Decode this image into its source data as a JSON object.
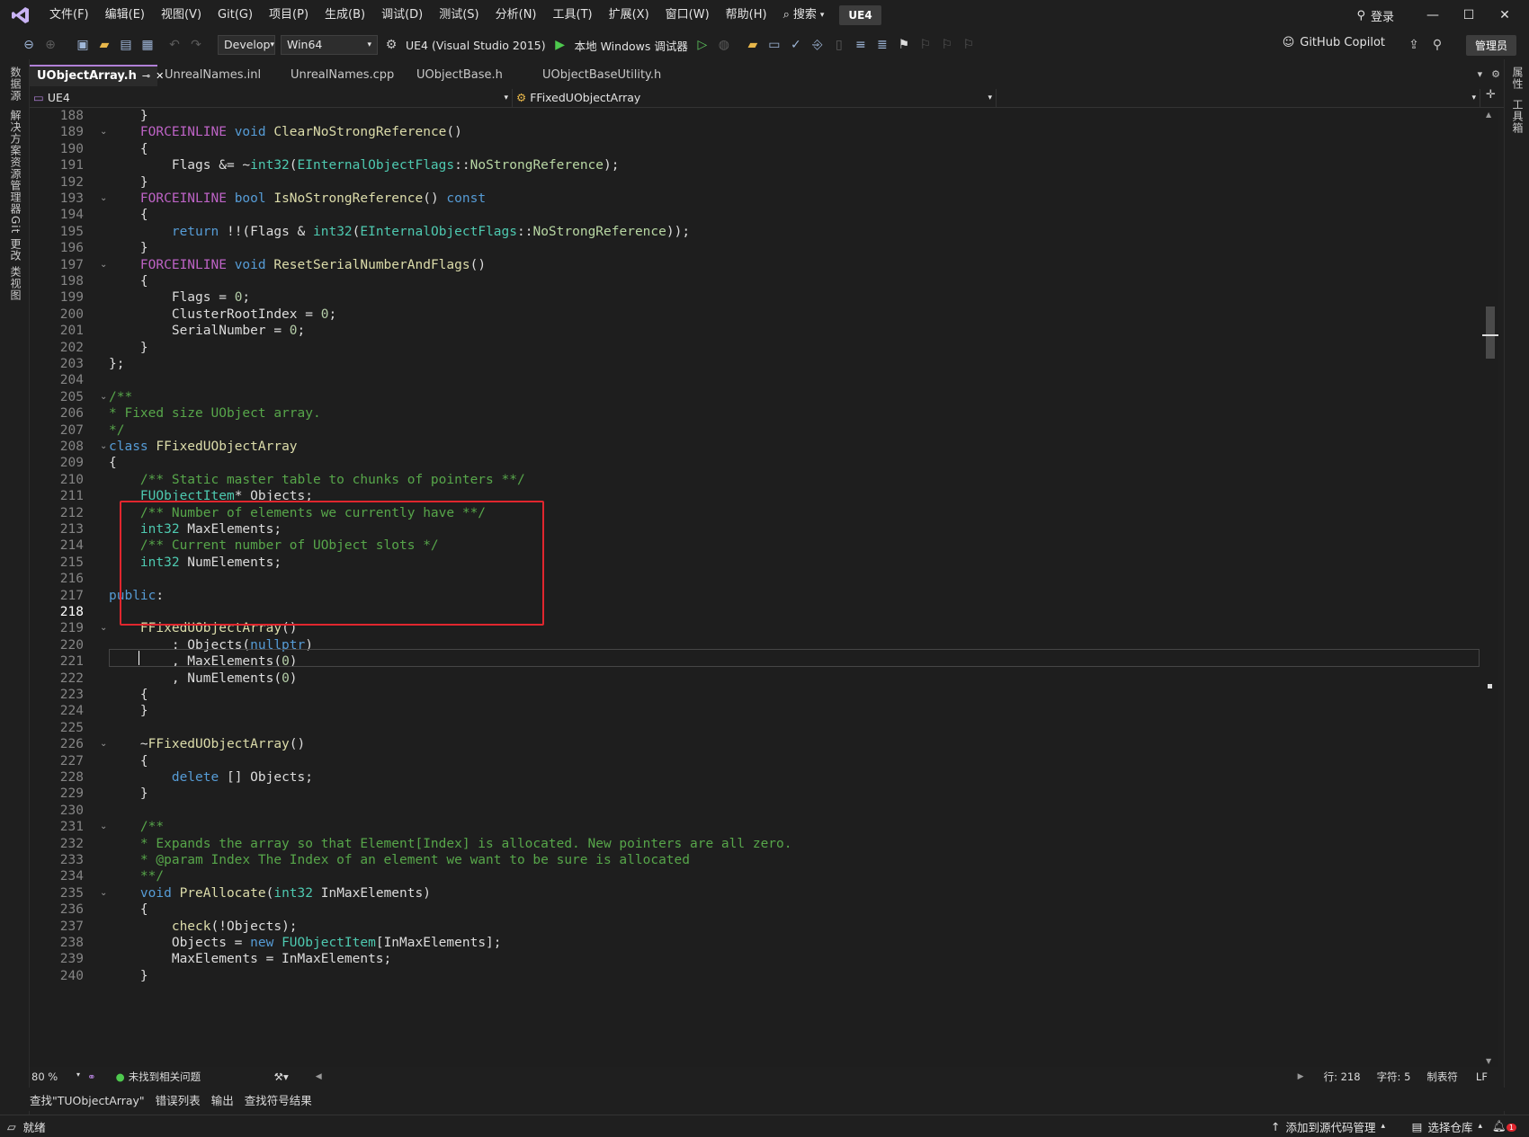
{
  "menubar": {
    "items": [
      "文件(F)",
      "编辑(E)",
      "视图(V)",
      "Git(G)",
      "项目(P)",
      "生成(B)",
      "调试(D)",
      "测试(S)",
      "分析(N)",
      "工具(T)",
      "扩展(X)",
      "窗口(W)",
      "帮助(H)"
    ],
    "search_label": "搜索",
    "solution_name": "UE4",
    "login_label": "登录"
  },
  "toolbar": {
    "configuration": "Develop",
    "platform": "Win64",
    "startup_project": "UE4 (Visual Studio 2015)",
    "debug_target": "本地 Windows 调试器",
    "copilot_label": "GitHub Copilot",
    "admin_label": "管理员"
  },
  "left_rail": [
    "数据源",
    "解决方案资源管理器",
    "Git 更改",
    "类视图"
  ],
  "right_rail": [
    "属性",
    "工具箱"
  ],
  "tabs": [
    {
      "label": "UObjectArray.h",
      "active": true
    },
    {
      "label": "UnrealNames.inl",
      "active": false
    },
    {
      "label": "UnrealNames.cpp",
      "active": false
    },
    {
      "label": "UObjectBase.h",
      "active": false
    },
    {
      "label": "UObjectBaseUtility.h",
      "active": false
    }
  ],
  "navbar": {
    "project": "UE4",
    "scope": "FFixedUObjectArray",
    "member": ""
  },
  "editor": {
    "first_line": 188,
    "current_line": 218,
    "lines": [
      {
        "n": 188,
        "fold": false,
        "t": "    }"
      },
      {
        "n": 189,
        "fold": true,
        "t": "    FORCEINLINE void ClearNoStrongReference()"
      },
      {
        "n": 190,
        "fold": false,
        "t": "    {"
      },
      {
        "n": 191,
        "fold": false,
        "t": "        Flags &= ~int32(EInternalObjectFlags::NoStrongReference);"
      },
      {
        "n": 192,
        "fold": false,
        "t": "    }"
      },
      {
        "n": 193,
        "fold": true,
        "t": "    FORCEINLINE bool IsNoStrongReference() const"
      },
      {
        "n": 194,
        "fold": false,
        "t": "    {"
      },
      {
        "n": 195,
        "fold": false,
        "t": "        return !!(Flags & int32(EInternalObjectFlags::NoStrongReference));"
      },
      {
        "n": 196,
        "fold": false,
        "t": "    }"
      },
      {
        "n": 197,
        "fold": true,
        "t": "    FORCEINLINE void ResetSerialNumberAndFlags()"
      },
      {
        "n": 198,
        "fold": false,
        "t": "    {"
      },
      {
        "n": 199,
        "fold": false,
        "t": "        Flags = 0;"
      },
      {
        "n": 200,
        "fold": false,
        "t": "        ClusterRootIndex = 0;"
      },
      {
        "n": 201,
        "fold": false,
        "t": "        SerialNumber = 0;"
      },
      {
        "n": 202,
        "fold": false,
        "t": "    }"
      },
      {
        "n": 203,
        "fold": false,
        "t": "};"
      },
      {
        "n": 204,
        "fold": false,
        "t": ""
      },
      {
        "n": 205,
        "fold": true,
        "t": "/**"
      },
      {
        "n": 206,
        "fold": false,
        "t": "* Fixed size UObject array."
      },
      {
        "n": 207,
        "fold": false,
        "t": "*/"
      },
      {
        "n": 208,
        "fold": true,
        "t": "class FFixedUObjectArray"
      },
      {
        "n": 209,
        "fold": false,
        "t": "{"
      },
      {
        "n": 210,
        "fold": false,
        "t": "    /** Static master table to chunks of pointers **/"
      },
      {
        "n": 211,
        "fold": false,
        "t": "    FUObjectItem* Objects;"
      },
      {
        "n": 212,
        "fold": false,
        "t": "    /** Number of elements we currently have **/"
      },
      {
        "n": 213,
        "fold": false,
        "t": "    int32 MaxElements;"
      },
      {
        "n": 214,
        "fold": false,
        "t": "    /** Current number of UObject slots */"
      },
      {
        "n": 215,
        "fold": false,
        "t": "    int32 NumElements;"
      },
      {
        "n": 216,
        "fold": false,
        "t": ""
      },
      {
        "n": 217,
        "fold": false,
        "t": "public:"
      },
      {
        "n": 218,
        "fold": false,
        "t": ""
      },
      {
        "n": 219,
        "fold": true,
        "t": "    FFixedUObjectArray()"
      },
      {
        "n": 220,
        "fold": false,
        "t": "        : Objects(nullptr)"
      },
      {
        "n": 221,
        "fold": false,
        "t": "        , MaxElements(0)"
      },
      {
        "n": 222,
        "fold": false,
        "t": "        , NumElements(0)"
      },
      {
        "n": 223,
        "fold": false,
        "t": "    {"
      },
      {
        "n": 224,
        "fold": false,
        "t": "    }"
      },
      {
        "n": 225,
        "fold": false,
        "t": ""
      },
      {
        "n": 226,
        "fold": true,
        "t": "    ~FFixedUObjectArray()"
      },
      {
        "n": 227,
        "fold": false,
        "t": "    {"
      },
      {
        "n": 228,
        "fold": false,
        "t": "        delete [] Objects;"
      },
      {
        "n": 229,
        "fold": false,
        "t": "    }"
      },
      {
        "n": 230,
        "fold": false,
        "t": ""
      },
      {
        "n": 231,
        "fold": true,
        "t": "    /**"
      },
      {
        "n": 232,
        "fold": false,
        "t": "    * Expands the array so that Element[Index] is allocated. New pointers are all zero."
      },
      {
        "n": 233,
        "fold": false,
        "t": "    * @param Index The Index of an element we want to be sure is allocated"
      },
      {
        "n": 234,
        "fold": false,
        "t": "    **/"
      },
      {
        "n": 235,
        "fold": true,
        "t": "    void PreAllocate(int32 InMaxElements)"
      },
      {
        "n": 236,
        "fold": false,
        "t": "    {"
      },
      {
        "n": 237,
        "fold": false,
        "t": "        check(!Objects);"
      },
      {
        "n": 238,
        "fold": false,
        "t": "        Objects = new FUObjectItem[InMaxElements];"
      },
      {
        "n": 239,
        "fold": false,
        "t": "        MaxElements = InMaxElements;"
      },
      {
        "n": 240,
        "fold": false,
        "t": "    }"
      }
    ]
  },
  "editor_status": {
    "zoom": "80 %",
    "issues": "未找到相关问题",
    "line": "行: 218",
    "col": "字符: 5",
    "indent": "制表符",
    "eol": "LF"
  },
  "tool_tabs": [
    "查找\"TUObjectArray\"",
    "错误列表",
    "输出",
    "查找符号结果"
  ],
  "statusbar": {
    "ready": "就绪",
    "source_control": "添加到源代码管理",
    "repo": "选择仓库",
    "notification_count": "1"
  }
}
